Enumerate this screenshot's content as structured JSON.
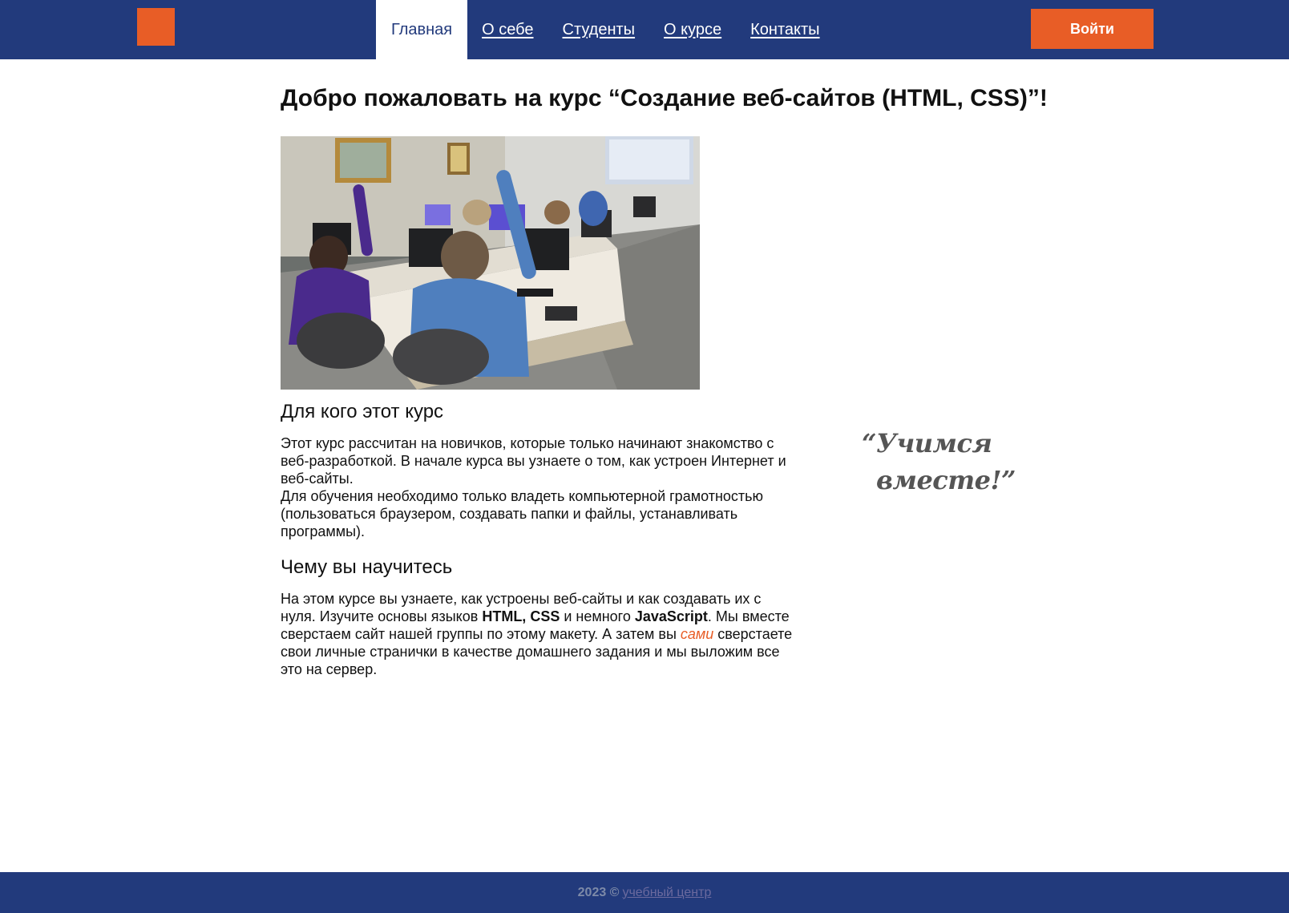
{
  "header": {
    "nav": [
      {
        "label": "Главная",
        "active": true
      },
      {
        "label": "О себе",
        "active": false
      },
      {
        "label": "Студенты",
        "active": false
      },
      {
        "label": "О курсе",
        "active": false
      },
      {
        "label": "Контакты",
        "active": false
      }
    ],
    "login_label": "Войти"
  },
  "colors": {
    "brand_blue": "#223a7c",
    "accent_orange": "#e85d26"
  },
  "main": {
    "title": "Добро пожаловать на курс “Создание веб-сайтов (HTML, CSS)”!",
    "section1": {
      "heading": "Для кого этот курс",
      "paragraph1": "Этот курс рассчитан на новичков, которые только начинают знакомство с веб-разработкой. В начале курса вы узнаете о том, как устроен Интернет и веб-сайты.",
      "paragraph2": "Для обучения необходимо только владеть компьютерной грамотностью (пользоваться браузером, создавать папки и файлы, устанавливать программы)."
    },
    "section2": {
      "heading": "Чему вы научитесь",
      "text_part1": "На этом курсе вы узнаете, как устроены веб-сайты и как создавать их с нуля. Изучите основы языков ",
      "bold1": "HTML, CSS",
      "text_part2": " и немного ",
      "bold2": "JavaScript",
      "text_part3": ". Мы вместе сверстаем сайт нашей группы по этому макету. А затем вы ",
      "highlight": "сами",
      "text_part4": " сверстаете свои личные странички в качестве домашнего задания и мы выложим все это на сервер."
    },
    "quote_line1": "“Учимся",
    "quote_line2": "вместе!”"
  },
  "footer": {
    "text": "2023 ©",
    "link": "учебный центр"
  }
}
